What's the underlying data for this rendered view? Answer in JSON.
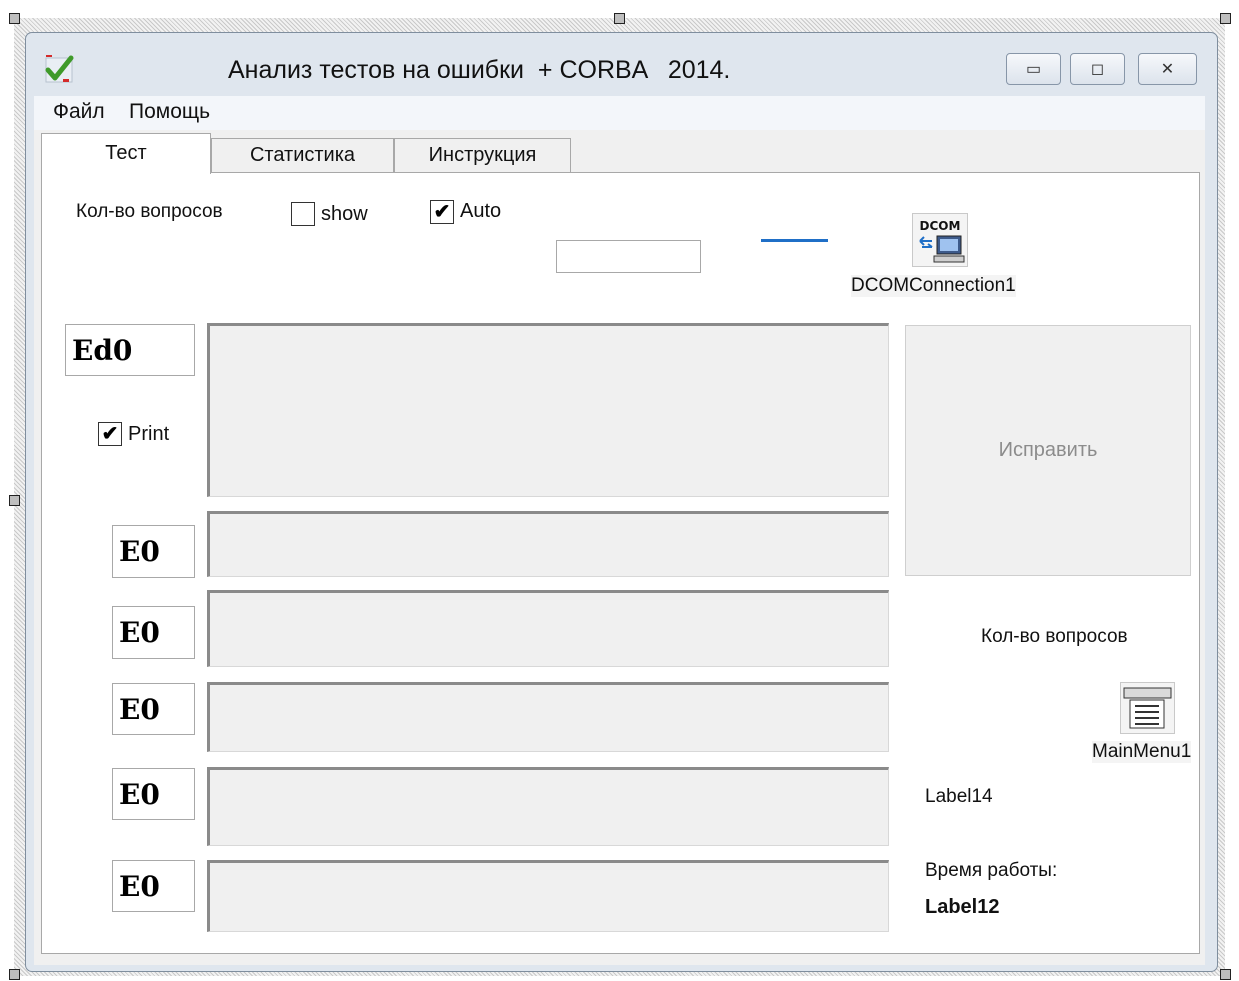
{
  "window": {
    "title": "Анализ тестов на ошибки  + CORBA   2014.",
    "icon": "check-app-icon",
    "buttons": {
      "minimize": "▭",
      "restore": "◻",
      "close": "✕"
    }
  },
  "menu": {
    "file": "Файл",
    "help": "Помощь"
  },
  "tabs": [
    {
      "label": "Тест",
      "active": true
    },
    {
      "label": "Статистика",
      "active": false
    },
    {
      "label": "Инструкция",
      "active": false
    }
  ],
  "top": {
    "count_label": "Кол-во вопросов",
    "show_label": "show",
    "show_checked": false,
    "auto_label": "Auto",
    "auto_checked": true,
    "auto_input_value": ""
  },
  "components": {
    "dcom_icon_text": "DCOM",
    "dcom_label": "DCOMConnection1",
    "mainmenu_label": "MainMenu1"
  },
  "left": {
    "main_edit": "Ed0",
    "print_label": "Print",
    "print_checked": true,
    "answer_edits": [
      "E0",
      "E0",
      "E0",
      "E0",
      "E0"
    ]
  },
  "right": {
    "fix_button": "Исправить",
    "count_label2": "Кол-во вопросов",
    "label14": "Label14",
    "worktime_label": "Время работы:",
    "label12": "Label12"
  },
  "colors": {
    "accent_line": "#1f6fc7",
    "disabled_text": "#8c8c8c",
    "window_frame": "#dfe6ee"
  }
}
